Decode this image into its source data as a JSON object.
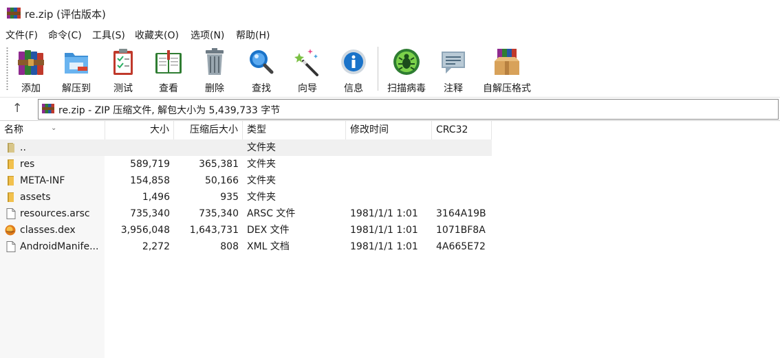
{
  "window": {
    "title": "re.zip (评估版本)",
    "app_icon": "winrar-books-icon"
  },
  "menu": [
    "文件(F)",
    "命令(C)",
    "工具(S)",
    "收藏夹(O)",
    "选项(N)",
    "帮助(H)"
  ],
  "toolbar": {
    "buttons": [
      {
        "label": "添加",
        "icon": "add-archive-icon"
      },
      {
        "label": "解压到",
        "icon": "extract-folder-icon"
      },
      {
        "label": "测试",
        "icon": "test-clipboard-icon"
      },
      {
        "label": "查看",
        "icon": "view-book-icon"
      },
      {
        "label": "删除",
        "icon": "trash-icon"
      },
      {
        "label": "查找",
        "icon": "find-magnifier-icon"
      },
      {
        "label": "向导",
        "icon": "wizard-wand-icon"
      },
      {
        "label": "信息",
        "icon": "info-icon"
      },
      {
        "label": "扫描病毒",
        "icon": "virus-scan-icon"
      },
      {
        "label": "注释",
        "icon": "comment-icon"
      },
      {
        "label": "自解压格式",
        "icon": "sfx-box-icon"
      }
    ]
  },
  "address": {
    "text": "re.zip - ZIP 压缩文件, 解包大小为 5,439,733 字节"
  },
  "columns": [
    "名称",
    "大小",
    "压缩后大小",
    "类型",
    "修改时间",
    "CRC32"
  ],
  "rows": [
    {
      "name": "..",
      "size": "",
      "packed": "",
      "type": "文件夹",
      "modified": "",
      "crc": "",
      "icon": "folder-up-icon"
    },
    {
      "name": "res",
      "size": "589,719",
      "packed": "365,381",
      "type": "文件夹",
      "modified": "",
      "crc": "",
      "icon": "folder-icon"
    },
    {
      "name": "META-INF",
      "size": "154,858",
      "packed": "50,166",
      "type": "文件夹",
      "modified": "",
      "crc": "",
      "icon": "folder-icon"
    },
    {
      "name": "assets",
      "size": "1,496",
      "packed": "935",
      "type": "文件夹",
      "modified": "",
      "crc": "",
      "icon": "folder-icon"
    },
    {
      "name": "resources.arsc",
      "size": "735,340",
      "packed": "735,340",
      "type": "ARSC 文件",
      "modified": "1981/1/1 1:01",
      "crc": "3164A19B",
      "icon": "file-icon"
    },
    {
      "name": "classes.dex",
      "size": "3,956,048",
      "packed": "1,643,731",
      "type": "DEX 文件",
      "modified": "1981/1/1 1:01",
      "crc": "1071BF8A",
      "icon": "dex-file-icon"
    },
    {
      "name": "AndroidManife...",
      "size": "2,272",
      "packed": "808",
      "type": "XML 文档",
      "modified": "1981/1/1 1:01",
      "crc": "4A665E72",
      "icon": "file-icon"
    }
  ],
  "colors": {
    "folder": "#e8b53c",
    "selection": "#f0f0f0",
    "accent": "#1a73c9"
  }
}
